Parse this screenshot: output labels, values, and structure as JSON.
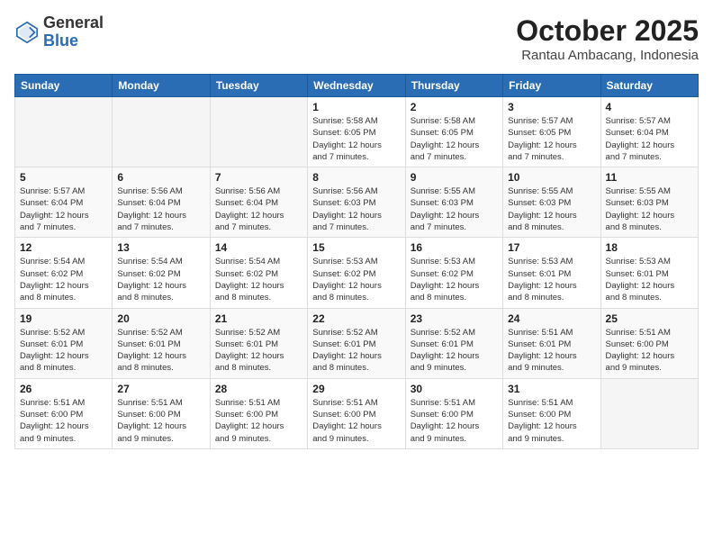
{
  "header": {
    "logo_general": "General",
    "logo_blue": "Blue",
    "title": "October 2025",
    "subtitle": "Rantau Ambacang, Indonesia"
  },
  "days_of_week": [
    "Sunday",
    "Monday",
    "Tuesday",
    "Wednesday",
    "Thursday",
    "Friday",
    "Saturday"
  ],
  "weeks": [
    [
      {
        "day": "",
        "info": ""
      },
      {
        "day": "",
        "info": ""
      },
      {
        "day": "",
        "info": ""
      },
      {
        "day": "1",
        "info": "Sunrise: 5:58 AM\nSunset: 6:05 PM\nDaylight: 12 hours\nand 7 minutes."
      },
      {
        "day": "2",
        "info": "Sunrise: 5:58 AM\nSunset: 6:05 PM\nDaylight: 12 hours\nand 7 minutes."
      },
      {
        "day": "3",
        "info": "Sunrise: 5:57 AM\nSunset: 6:05 PM\nDaylight: 12 hours\nand 7 minutes."
      },
      {
        "day": "4",
        "info": "Sunrise: 5:57 AM\nSunset: 6:04 PM\nDaylight: 12 hours\nand 7 minutes."
      }
    ],
    [
      {
        "day": "5",
        "info": "Sunrise: 5:57 AM\nSunset: 6:04 PM\nDaylight: 12 hours\nand 7 minutes."
      },
      {
        "day": "6",
        "info": "Sunrise: 5:56 AM\nSunset: 6:04 PM\nDaylight: 12 hours\nand 7 minutes."
      },
      {
        "day": "7",
        "info": "Sunrise: 5:56 AM\nSunset: 6:04 PM\nDaylight: 12 hours\nand 7 minutes."
      },
      {
        "day": "8",
        "info": "Sunrise: 5:56 AM\nSunset: 6:03 PM\nDaylight: 12 hours\nand 7 minutes."
      },
      {
        "day": "9",
        "info": "Sunrise: 5:55 AM\nSunset: 6:03 PM\nDaylight: 12 hours\nand 7 minutes."
      },
      {
        "day": "10",
        "info": "Sunrise: 5:55 AM\nSunset: 6:03 PM\nDaylight: 12 hours\nand 8 minutes."
      },
      {
        "day": "11",
        "info": "Sunrise: 5:55 AM\nSunset: 6:03 PM\nDaylight: 12 hours\nand 8 minutes."
      }
    ],
    [
      {
        "day": "12",
        "info": "Sunrise: 5:54 AM\nSunset: 6:02 PM\nDaylight: 12 hours\nand 8 minutes."
      },
      {
        "day": "13",
        "info": "Sunrise: 5:54 AM\nSunset: 6:02 PM\nDaylight: 12 hours\nand 8 minutes."
      },
      {
        "day": "14",
        "info": "Sunrise: 5:54 AM\nSunset: 6:02 PM\nDaylight: 12 hours\nand 8 minutes."
      },
      {
        "day": "15",
        "info": "Sunrise: 5:53 AM\nSunset: 6:02 PM\nDaylight: 12 hours\nand 8 minutes."
      },
      {
        "day": "16",
        "info": "Sunrise: 5:53 AM\nSunset: 6:02 PM\nDaylight: 12 hours\nand 8 minutes."
      },
      {
        "day": "17",
        "info": "Sunrise: 5:53 AM\nSunset: 6:01 PM\nDaylight: 12 hours\nand 8 minutes."
      },
      {
        "day": "18",
        "info": "Sunrise: 5:53 AM\nSunset: 6:01 PM\nDaylight: 12 hours\nand 8 minutes."
      }
    ],
    [
      {
        "day": "19",
        "info": "Sunrise: 5:52 AM\nSunset: 6:01 PM\nDaylight: 12 hours\nand 8 minutes."
      },
      {
        "day": "20",
        "info": "Sunrise: 5:52 AM\nSunset: 6:01 PM\nDaylight: 12 hours\nand 8 minutes."
      },
      {
        "day": "21",
        "info": "Sunrise: 5:52 AM\nSunset: 6:01 PM\nDaylight: 12 hours\nand 8 minutes."
      },
      {
        "day": "22",
        "info": "Sunrise: 5:52 AM\nSunset: 6:01 PM\nDaylight: 12 hours\nand 8 minutes."
      },
      {
        "day": "23",
        "info": "Sunrise: 5:52 AM\nSunset: 6:01 PM\nDaylight: 12 hours\nand 9 minutes."
      },
      {
        "day": "24",
        "info": "Sunrise: 5:51 AM\nSunset: 6:01 PM\nDaylight: 12 hours\nand 9 minutes."
      },
      {
        "day": "25",
        "info": "Sunrise: 5:51 AM\nSunset: 6:00 PM\nDaylight: 12 hours\nand 9 minutes."
      }
    ],
    [
      {
        "day": "26",
        "info": "Sunrise: 5:51 AM\nSunset: 6:00 PM\nDaylight: 12 hours\nand 9 minutes."
      },
      {
        "day": "27",
        "info": "Sunrise: 5:51 AM\nSunset: 6:00 PM\nDaylight: 12 hours\nand 9 minutes."
      },
      {
        "day": "28",
        "info": "Sunrise: 5:51 AM\nSunset: 6:00 PM\nDaylight: 12 hours\nand 9 minutes."
      },
      {
        "day": "29",
        "info": "Sunrise: 5:51 AM\nSunset: 6:00 PM\nDaylight: 12 hours\nand 9 minutes."
      },
      {
        "day": "30",
        "info": "Sunrise: 5:51 AM\nSunset: 6:00 PM\nDaylight: 12 hours\nand 9 minutes."
      },
      {
        "day": "31",
        "info": "Sunrise: 5:51 AM\nSunset: 6:00 PM\nDaylight: 12 hours\nand 9 minutes."
      },
      {
        "day": "",
        "info": ""
      }
    ]
  ]
}
